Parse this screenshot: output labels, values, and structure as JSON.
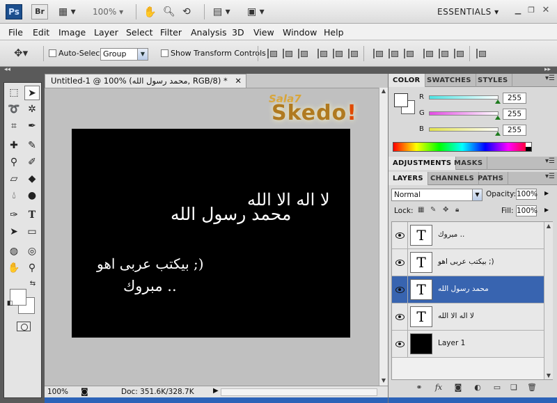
{
  "appbar": {
    "ps": "Ps",
    "br": "Br",
    "zoom": "100%",
    "workspace": "ESSENTIALS"
  },
  "menu": [
    "File",
    "Edit",
    "Image",
    "Layer",
    "Select",
    "Filter",
    "Analysis",
    "3D",
    "View",
    "Window",
    "Help"
  ],
  "options": {
    "auto_select_label": "Auto-Select:",
    "auto_select_value": "Group",
    "show_transform_label": "Show Transform Controls"
  },
  "document": {
    "tab_title": "Untitled-1 @ 100% (محمد رسول الله, RGB/8) *",
    "logo_small": "Sala7",
    "logo_big": "Skedo",
    "logo_bang": "!",
    "text1": "لا اله الا الله",
    "text2": "محمد رسول الله",
    "text3": "بيكتب عربى اهو ;)",
    "text4": "مبروك ..",
    "status_zoom": "100%",
    "status_doc": "Doc: 351.6K/328.7K"
  },
  "color_panel": {
    "tabs": [
      "COLOR",
      "SWATCHES",
      "STYLES"
    ],
    "r_label": "R",
    "g_label": "G",
    "b_label": "B",
    "r": "255",
    "g": "255",
    "b": "255",
    "accent_r": "#4de3e3",
    "accent_g": "#e34de3",
    "accent_b": "#e3e34d"
  },
  "adjustments_panel": {
    "tabs": [
      "ADJUSTMENTS",
      "MASKS"
    ]
  },
  "layers_panel": {
    "tabs": [
      "LAYERS",
      "CHANNELS",
      "PATHS"
    ],
    "blend_mode": "Normal",
    "opacity_label": "Opacity:",
    "opacity": "100%",
    "lock_label": "Lock:",
    "fill_label": "Fill:",
    "fill": "100%",
    "layers": [
      {
        "name": "مبروك ..",
        "thumb": "T"
      },
      {
        "name": "بيكتب عربى اهو ;)",
        "thumb": "T"
      },
      {
        "name": "محمد رسول الله",
        "thumb": "T"
      },
      {
        "name": "لا اله الا الله",
        "thumb": "T"
      },
      {
        "name": "Layer 1",
        "thumb": ""
      }
    ],
    "selected_color": "#3864b0"
  }
}
